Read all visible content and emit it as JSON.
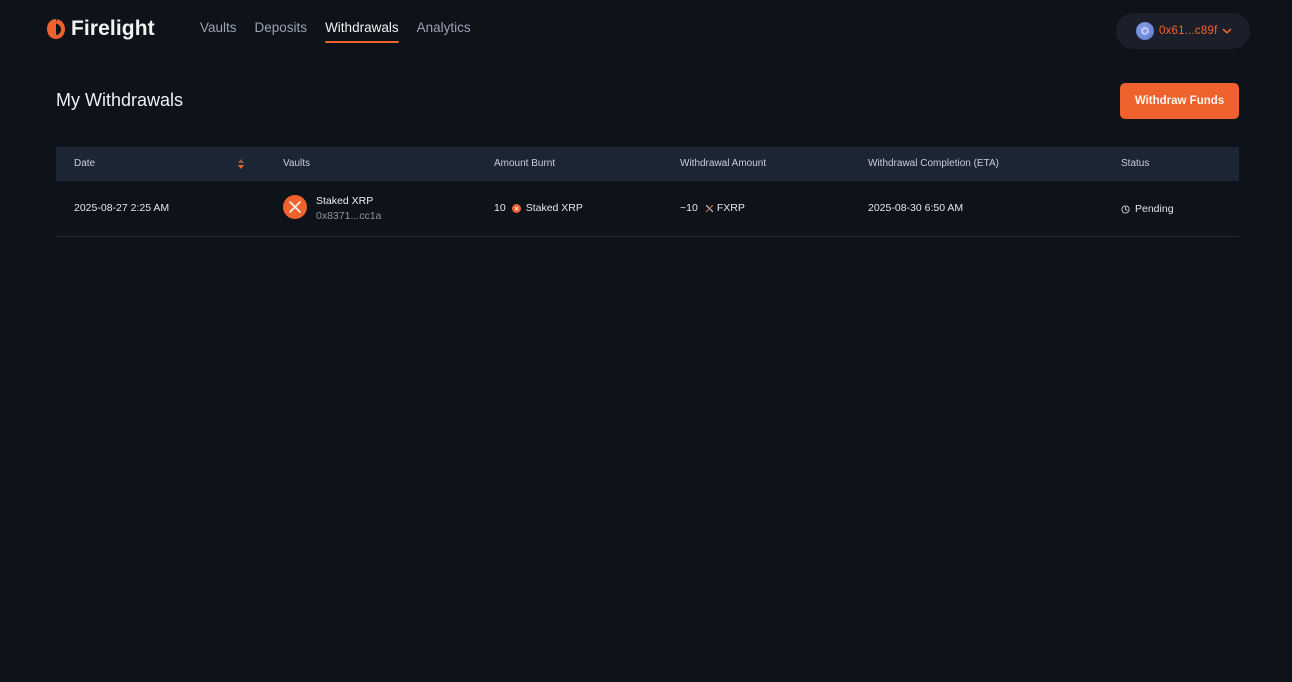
{
  "brand": {
    "name": "Firelight",
    "accent": "#f0622d"
  },
  "nav": {
    "items": [
      {
        "label": "Vaults"
      },
      {
        "label": "Deposits"
      },
      {
        "label": "Withdrawals",
        "active": true
      },
      {
        "label": "Analytics"
      }
    ]
  },
  "wallet": {
    "address": "0x61...c89f",
    "icon": "wallet-avatar-icon"
  },
  "page": {
    "title": "My Withdrawals",
    "primary_action": "Withdraw Funds"
  },
  "table": {
    "columns": [
      "Date",
      "Vaults",
      "Amount Burnt",
      "Withdrawal Amount",
      "Withdrawal Completion (ETA)",
      "Status"
    ],
    "rows": [
      {
        "date": "2025-08-27 2:25 AM",
        "vault_name": "Staked XRP",
        "vault_address": "0x8371...cc1a",
        "amount_burnt_value": "10",
        "amount_burnt_token": "Staked XRP",
        "withdrawal_amount_value": "~10",
        "withdrawal_amount_token": "FXRP",
        "eta": "2025-08-30 6:50 AM",
        "status": "Pending"
      }
    ]
  }
}
